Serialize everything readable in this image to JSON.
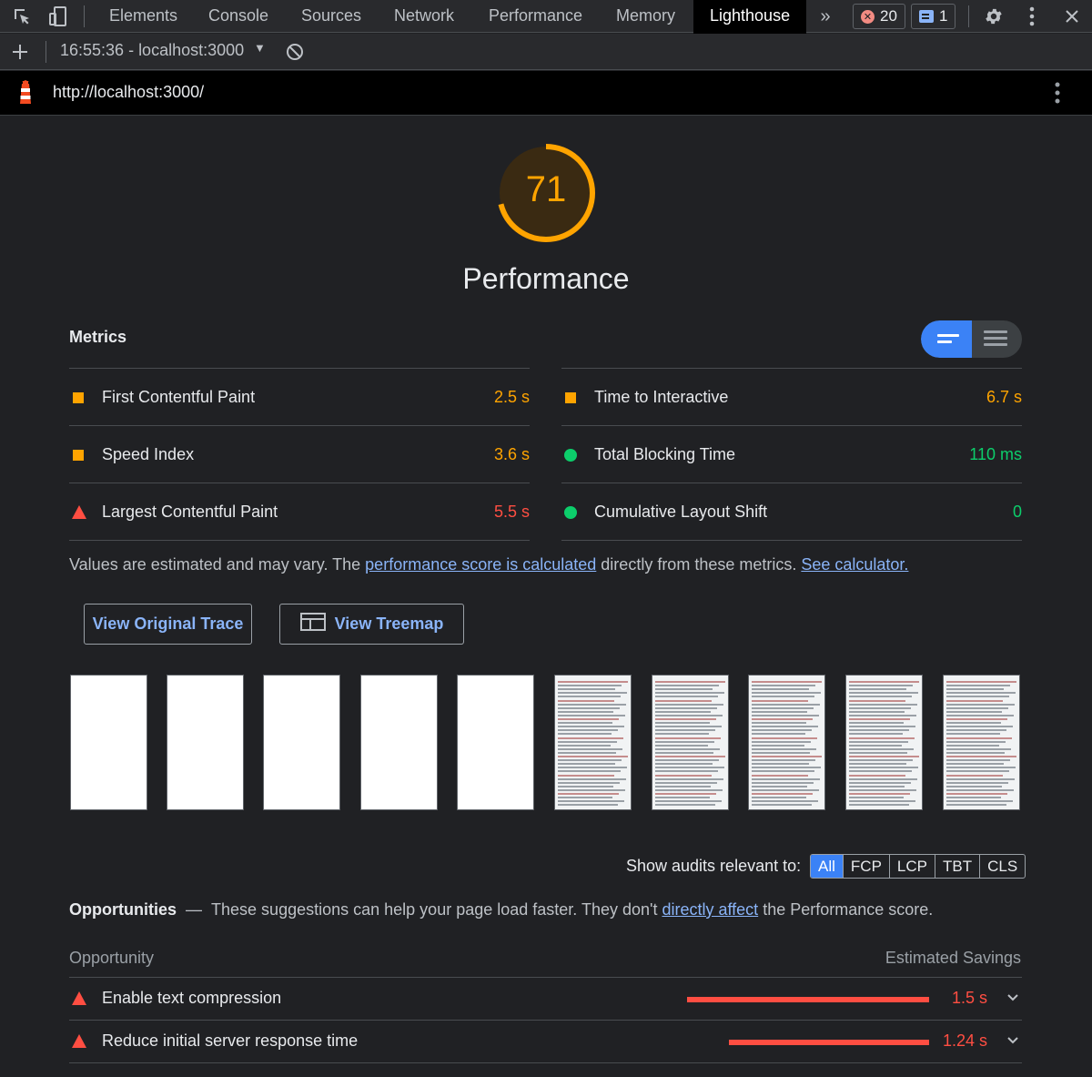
{
  "devtools": {
    "tabs": [
      "Elements",
      "Console",
      "Sources",
      "Network",
      "Performance",
      "Memory",
      "Lighthouse"
    ],
    "active_tab": "Lighthouse",
    "errors_count": "20",
    "messages_count": "1",
    "report_selector": "16:55:36 - localhost:3000"
  },
  "report": {
    "url": "http://localhost:3000/",
    "score": "71",
    "category": "Performance",
    "metrics_heading": "Metrics",
    "metrics": [
      {
        "label": "First Contentful Paint",
        "value": "2.5 s",
        "status": "average"
      },
      {
        "label": "Time to Interactive",
        "value": "6.7 s",
        "status": "average"
      },
      {
        "label": "Speed Index",
        "value": "3.6 s",
        "status": "average"
      },
      {
        "label": "Total Blocking Time",
        "value": "110 ms",
        "status": "pass"
      },
      {
        "label": "Largest Contentful Paint",
        "value": "5.5 s",
        "status": "fail"
      },
      {
        "label": "Cumulative Layout Shift",
        "value": "0",
        "status": "pass"
      }
    ],
    "note_prefix": "Values are estimated and may vary. The ",
    "note_link1": "performance score is calculated",
    "note_middle": " directly from these metrics. ",
    "note_link2": "See calculator.",
    "buttons": {
      "view_trace": "View Original Trace",
      "view_treemap": "View Treemap"
    },
    "show_audits_label": "Show audits relevant to:",
    "filters": [
      "All",
      "FCP",
      "LCP",
      "TBT",
      "CLS"
    ],
    "active_filter": "All",
    "opportunities": {
      "title": "Opportunities",
      "dash": "—",
      "desc_prefix": "These suggestions can help your page load faster. They don't ",
      "desc_link": "directly affect",
      "desc_suffix": " the Performance score.",
      "col_left": "Opportunity",
      "col_right": "Estimated Savings",
      "items": [
        {
          "label": "Enable text compression",
          "value": "1.5 s",
          "savings_s": 1.5
        },
        {
          "label": "Reduce initial server response time",
          "value": "1.24 s",
          "savings_s": 1.24
        }
      ]
    }
  },
  "colors": {
    "pass": "#0cce6b",
    "average": "#ffa400",
    "fail": "#ff4e42",
    "link": "#8ab4f8",
    "accent": "#3b82f6"
  },
  "icons": [
    "inspect-icon",
    "device-toggle-icon",
    "more-tabs-icon",
    "error-icon",
    "message-icon",
    "settings-icon",
    "kebab-menu-icon",
    "close-icon",
    "add-icon",
    "clear-icon",
    "lighthouse-logo-icon",
    "treemap-icon",
    "chevron-down-icon"
  ]
}
